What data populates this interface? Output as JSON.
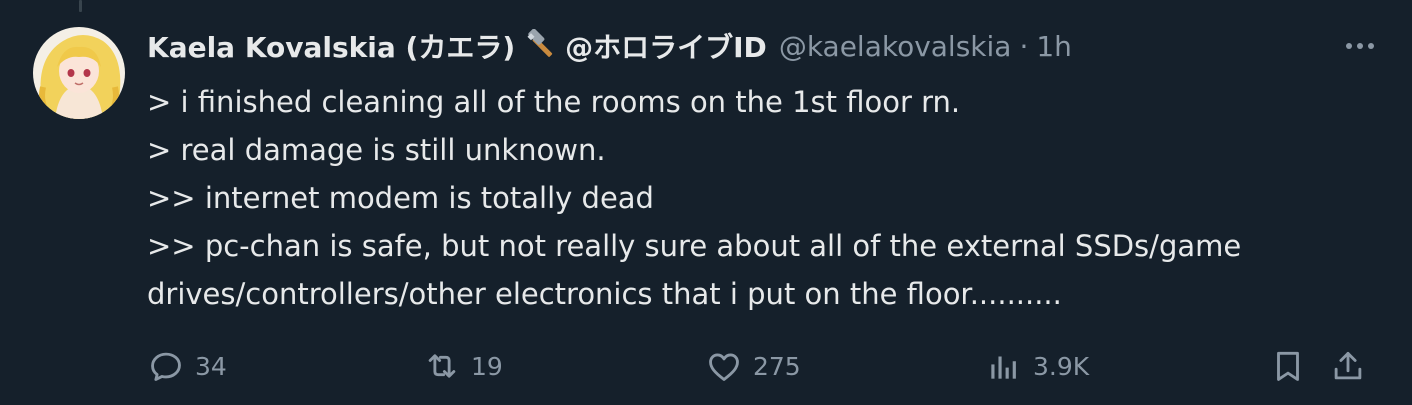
{
  "tweet": {
    "author_name": "Kaela Kovalskia (カエラ)",
    "affiliation": "@ホロライブID",
    "handle": "@kaelakovalskia",
    "separator": "·",
    "time": "1h",
    "lines": [
      "> i finished cleaning all of the rooms on the 1st floor rn.",
      "> real damage is still unknown.",
      ">> internet modem is totally dead",
      ">> pc-chan is safe, but not really sure about all of the external SSDs/game",
      "drives/controllers/other electronics that i put on the floor.........."
    ]
  },
  "actions": {
    "replies": "34",
    "reposts": "19",
    "likes": "275",
    "views": "3.9K"
  },
  "icons": {
    "name_emoji": "hammer-icon",
    "more": "more-icon",
    "reply": "reply-icon",
    "repost": "repost-icon",
    "like": "heart-icon",
    "views": "analytics-icon",
    "bookmark": "bookmark-icon",
    "share": "share-icon"
  },
  "colors": {
    "background": "#15202b",
    "text": "#e7e9ea",
    "secondary": "#8b98a5"
  }
}
